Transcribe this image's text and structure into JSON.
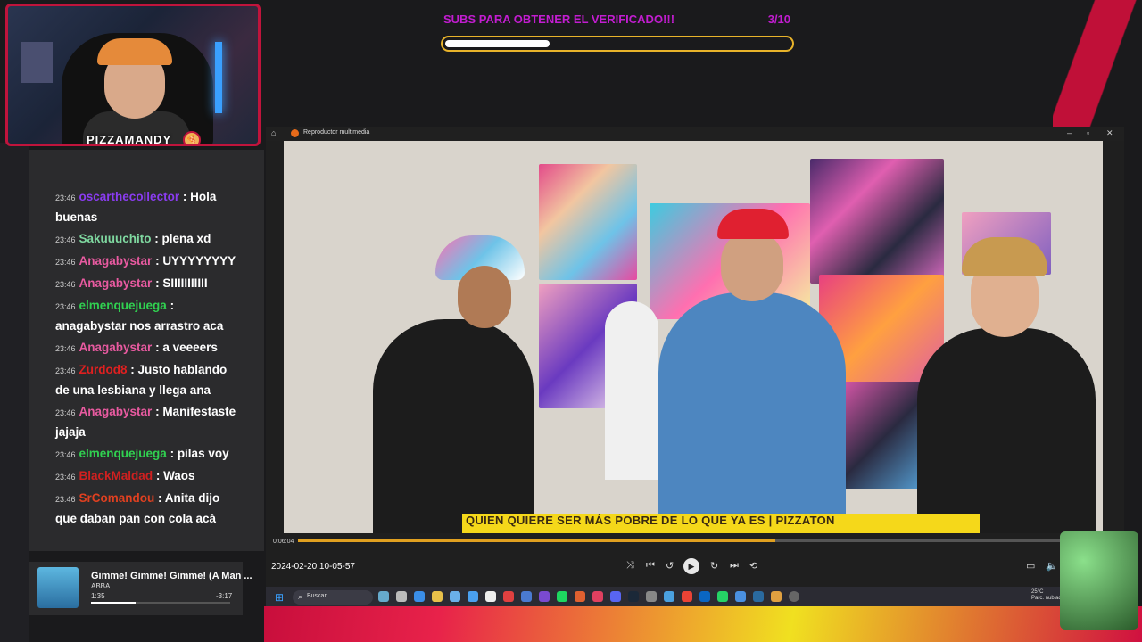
{
  "webcam": {
    "streamer_name": "PIZZAMANDY"
  },
  "goal": {
    "label": "SUBS PARA OBTENER EL VERIFICADO!!!",
    "count": "3/10",
    "progress": 0.3
  },
  "chat": {
    "messages": [
      {
        "time": "23:46",
        "user": "oscarthecollector",
        "color": "#8a3cf0",
        "text": "Hola buenas"
      },
      {
        "time": "23:46",
        "user": "Sakuuuchito",
        "color": "#7fd8a0",
        "text": "plena xd"
      },
      {
        "time": "23:46",
        "user": "Anagabystar",
        "color": "#e85aa0",
        "text": "UYYYYYYYY"
      },
      {
        "time": "23:46",
        "user": "Anagabystar",
        "color": "#e85aa0",
        "text": "SIIIIIIIIIII"
      },
      {
        "time": "23:46",
        "user": "elmenquejuega",
        "color": "#30d050",
        "text": "anagabystar nos arrastro aca"
      },
      {
        "time": "23:46",
        "user": "Anagabystar",
        "color": "#e85aa0",
        "text": "a veeeers"
      },
      {
        "time": "23:46",
        "user": "Zurdod8",
        "color": "#e02020",
        "text": "Justo hablando de una lesbiana y llega ana"
      },
      {
        "time": "23:46",
        "user": "Anagabystar",
        "color": "#e85aa0",
        "text": "Manifestaste jajaja"
      },
      {
        "time": "23:46",
        "user": "elmenquejuega",
        "color": "#30d050",
        "text": "pilas voy"
      },
      {
        "time": "23:46",
        "user": "BlackMaldad",
        "color": "#d02020",
        "text": "Waos"
      },
      {
        "time": "23:46",
        "user": "SrComandou",
        "color": "#e04020",
        "text": "Anita dijo que daban pan con cola acá"
      }
    ]
  },
  "music": {
    "title": "Gimme! Gimme! Gimme! (A Man ...",
    "artist": "ABBA",
    "elapsed": "1:35",
    "remaining": "-3:17",
    "progress": 0.32
  },
  "player": {
    "title": "Reproductor multimedia",
    "lower_third": "QUIEN QUIERE SER MÁS POBRE DE LO QUE YA ES | PIZZATON",
    "time_small": "0:06:04",
    "seek_progress": 0.6,
    "recorded_date": "2024-02-20 10-05-57"
  },
  "taskbar": {
    "search_placeholder": "Buscar",
    "weather_temp": "25°C",
    "weather_desc": "Parc. nublado"
  },
  "colors": {
    "accent": "#c21dd0",
    "goal_border": "#e8b32a",
    "brand_red": "#c0143c"
  }
}
